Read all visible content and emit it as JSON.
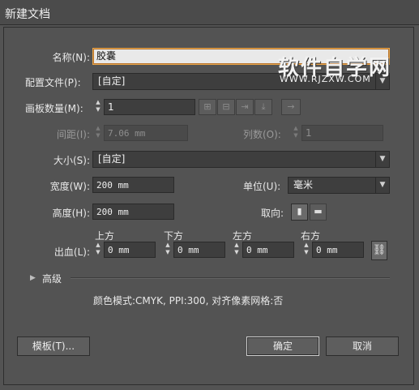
{
  "window": {
    "title": "新建文档"
  },
  "name": {
    "label": "名称(N):",
    "value": "胶囊"
  },
  "profile": {
    "label": "配置文件(P):",
    "value": "[自定]"
  },
  "artboards": {
    "label": "画板数量(M):",
    "value": "1"
  },
  "spacing": {
    "label": "间距(I):",
    "value": "7.06 mm"
  },
  "columns": {
    "label": "列数(O):",
    "value": "1"
  },
  "size": {
    "label": "大小(S):",
    "value": "[自定]"
  },
  "width": {
    "label": "宽度(W):",
    "value": "200 mm"
  },
  "units": {
    "label": "单位(U):",
    "value": "毫米"
  },
  "height": {
    "label": "高度(H):",
    "value": "200 mm"
  },
  "orientation": {
    "label": "取向:"
  },
  "bleed": {
    "label": "出血(L):",
    "top": {
      "label": "上方",
      "value": "0 mm"
    },
    "bottom": {
      "label": "下方",
      "value": "0 mm"
    },
    "left": {
      "label": "左方",
      "value": "0 mm"
    },
    "right": {
      "label": "右方",
      "value": "0 mm"
    }
  },
  "advanced": {
    "label": "高级"
  },
  "info": {
    "text": "颜色模式:CMYK, PPI:300, 对齐像素网格:否"
  },
  "buttons": {
    "templates": "模板(T)...",
    "ok": "确定",
    "cancel": "取消"
  },
  "watermark": {
    "line1": "软件自学网",
    "line2": "WWW.RJZXW.COM"
  },
  "icons": {
    "spinner": "spinner-arrows-icon",
    "grid_by_row": "grid-by-row-icon",
    "grid_by_column": "grid-by-column-icon",
    "arrange_by_row": "arrange-by-row-icon",
    "arrange_by_column": "arrange-by-column-icon",
    "layout_direction": "layout-direction-arrow-icon",
    "portrait": "portrait-orientation-icon",
    "landscape": "landscape-orientation-icon",
    "chain": "chain-link-icon",
    "disclosure": "disclosure-triangle-icon"
  },
  "colors": {
    "background": "#535353",
    "field": "#3e3e3e",
    "focus_border": "#e8a54b"
  }
}
